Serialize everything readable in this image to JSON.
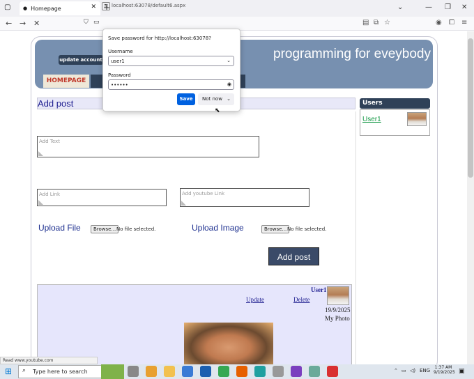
{
  "browser": {
    "tab_title": "Homepage",
    "url": "localhost:63078/default6.aspx",
    "new_tab": "+",
    "status_text": "Read www.youtube.com"
  },
  "dialog": {
    "title": "Save password for http://localhost:63078?",
    "username_label": "Username",
    "username_value": "user1",
    "password_label": "Password",
    "password_value": "••••••",
    "save_label": "Save",
    "not_now_label": "Not now"
  },
  "header": {
    "site_title": "programming for eveybody",
    "update_account": "update account",
    "home_tab": "HOMEPAGE"
  },
  "main": {
    "section_title": "Add post",
    "text_placeholder": "Add Text",
    "link_placeholder": "Add Link",
    "youtube_placeholder": "Add youtube Link",
    "upload_file_label": "Upload File",
    "upload_image_label": "Upload Image",
    "browse_label": "Browse...",
    "no_file": "No file selected.",
    "add_post_button": "Add post"
  },
  "sidebar": {
    "title": "Users",
    "users": [
      {
        "name": "User1"
      }
    ]
  },
  "post": {
    "user": "User1",
    "update": "Update",
    "delete": "Delete",
    "date": "19/9/2025",
    "text": "My Photo"
  },
  "taskbar": {
    "search_placeholder": "Type here to search",
    "language": "ENG",
    "time": "1:37 AM",
    "date": "9/19/2025"
  }
}
